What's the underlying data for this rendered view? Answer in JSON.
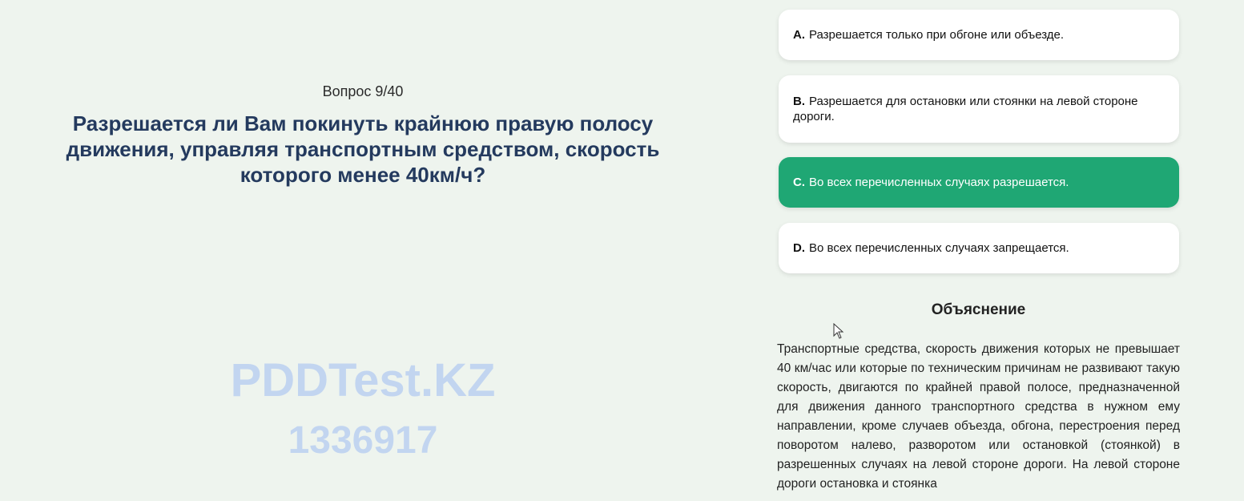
{
  "question": {
    "counter": "Вопрос 9/40",
    "text": "Разрешается ли Вам покинуть крайнюю правую полосу движения, управляя транспортным средством, скорость которого менее 40км/ч?"
  },
  "watermark": {
    "site": "PDDTest.KZ",
    "id": "1336917"
  },
  "answers": [
    {
      "letter": "A.",
      "text": "Разрешается только при обгоне или объезде.",
      "selected": false
    },
    {
      "letter": "B.",
      "text": "Разрешается для остановки или стоянки на левой стороне дороги.",
      "selected": false
    },
    {
      "letter": "C.",
      "text": "Во всех перечисленных случаях разрешается.",
      "selected": true
    },
    {
      "letter": "D.",
      "text": "Во всех перечисленных случаях запрещается.",
      "selected": false
    }
  ],
  "explanation": {
    "title": "Объяснение",
    "text": "Транспортные средства, скорость движения которых не превышает 40 км/час или которые по техническим причинам не развивают такую скорость, двигаются по крайней правой полосе, предназначенной для движения данного транспортного средства в нужном ему направлении, кроме случаев объезда, обгона, перестроения перед поворотом налево, разворотом или остановкой (стоянкой) в разрешенных случаях на левой стороне дороги. На левой стороне дороги остановка и стоянка"
  },
  "colors": {
    "background": "#eef4ee",
    "question_text": "#243a5e",
    "selected_answer": "#1fa774",
    "watermark": "#c2d5f0"
  }
}
